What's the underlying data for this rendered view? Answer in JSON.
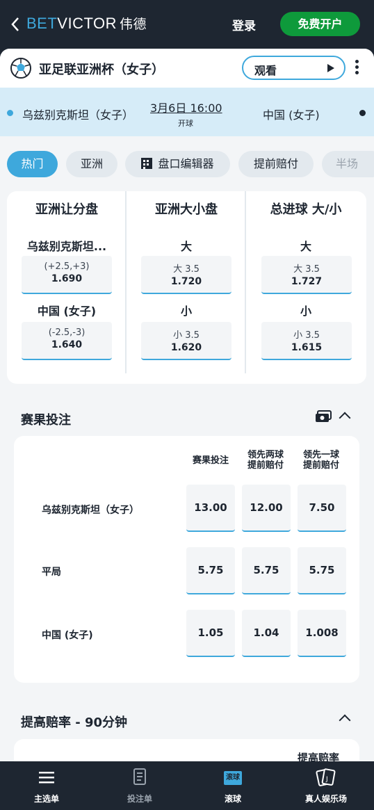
{
  "header": {
    "brand_bet": "BET",
    "brand_victor": "VICTOR",
    "brand_cn": "伟德",
    "login": "登录",
    "register": "免费开户"
  },
  "event": {
    "title": "亚足联亚洲杯（女子）",
    "watch": "观看",
    "home": "乌兹别克斯坦（女子）",
    "away": "中国 (女子)",
    "kickoff_date": "3月6日 16:00",
    "kickoff_label": "开球"
  },
  "tabs": [
    {
      "label": "热门",
      "active": true
    },
    {
      "label": "亚洲",
      "active": false
    },
    {
      "label": "盘口编辑器",
      "active": false
    },
    {
      "label": "提前赔付",
      "active": false
    },
    {
      "label": "半场",
      "active": false
    }
  ],
  "markets": [
    {
      "title": "亚洲让分盘",
      "selections": [
        {
          "label": "乌兹别克斯坦...",
          "line": "(+2.5,+3)",
          "price": "1.690"
        },
        {
          "label": "中国 (女子)",
          "line": "(-2.5,-3)",
          "price": "1.640"
        }
      ]
    },
    {
      "title": "亚洲大小盘",
      "selections": [
        {
          "label": "大",
          "line": "大 3.5",
          "price": "1.720"
        },
        {
          "label": "小",
          "line": "小 3.5",
          "price": "1.620"
        }
      ]
    },
    {
      "title": "总进球 大/小",
      "selections": [
        {
          "label": "大",
          "line": "大 3.5",
          "price": "1.727"
        },
        {
          "label": "小",
          "line": "小 3.5",
          "price": "1.615"
        }
      ]
    }
  ],
  "match_result": {
    "title": "赛果投注",
    "headers": [
      "赛果投注",
      "领先两球\n提前赔付",
      "领先一球\n提前赔付"
    ],
    "rows": [
      {
        "label": "乌兹别克斯坦（女子）",
        "prices": [
          "13.00",
          "12.00",
          "7.50"
        ]
      },
      {
        "label": "平局",
        "prices": [
          "5.75",
          "5.75",
          "5.75"
        ]
      },
      {
        "label": "中国 (女子)",
        "prices": [
          "1.05",
          "1.04",
          "1.008"
        ]
      }
    ]
  },
  "boost": {
    "title": "提高赔率 - 90分钟",
    "column_header": "提高赔率"
  },
  "bottom_nav": [
    {
      "label": "主选单",
      "icon": "menu-icon"
    },
    {
      "label": "投注单",
      "icon": "betslip-icon"
    },
    {
      "label": "滚球",
      "icon": "live-icon",
      "badge": "滚球"
    },
    {
      "label": "真人娱乐场",
      "icon": "cards-icon"
    }
  ],
  "colors": {
    "accent": "#3ea8dc",
    "cta": "#0e9a3b",
    "dark": "#1e2631"
  }
}
